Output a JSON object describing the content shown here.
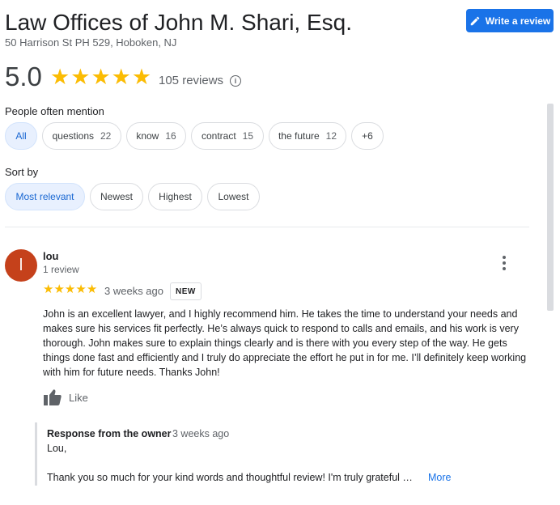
{
  "header": {
    "title": "Law Offices of John M. Shari, Esq.",
    "address": "50 Harrison St PH 529, Hoboken, NJ",
    "write_review_label": "Write a review"
  },
  "summary": {
    "rating": "5.0",
    "stars": 5,
    "review_count": "105 reviews"
  },
  "mentions": {
    "label": "People often mention",
    "chips": [
      {
        "label": "All",
        "count": "",
        "active": true
      },
      {
        "label": "questions",
        "count": "22"
      },
      {
        "label": "know",
        "count": "16"
      },
      {
        "label": "contract",
        "count": "15"
      },
      {
        "label": "the future",
        "count": "12"
      },
      {
        "label": "+6",
        "count": ""
      }
    ]
  },
  "sort": {
    "label": "Sort by",
    "options": [
      {
        "label": "Most relevant",
        "active": true
      },
      {
        "label": "Newest"
      },
      {
        "label": "Highest"
      },
      {
        "label": "Lowest"
      }
    ]
  },
  "review": {
    "avatar_letter": "l",
    "name": "lou",
    "meta": "1 review",
    "stars": 5,
    "time": "3 weeks ago",
    "badge": "NEW",
    "text": "John is an excellent lawyer, and I highly recommend him. He takes the time to understand your needs and makes sure his services fit perfectly. He’s always quick to respond to calls and emails, and his work is very thorough. John makes sure to explain things clearly and is there with you every step of the way. He gets things done fast and efficiently and I truly do appreciate the effort he put in for me. I’ll definitely keep working with him for future needs. Thanks John!",
    "like_label": "Like"
  },
  "owner_response": {
    "title": "Response from the owner",
    "time": "3 weeks ago",
    "greeting": "Lou,",
    "text": "Thank you so much for your kind words and thoughtful review! I'm truly grateful …",
    "more_label": "More"
  },
  "colors": {
    "accent": "#1a73e8",
    "star": "#fbbc04",
    "avatar": "#c5411b"
  }
}
